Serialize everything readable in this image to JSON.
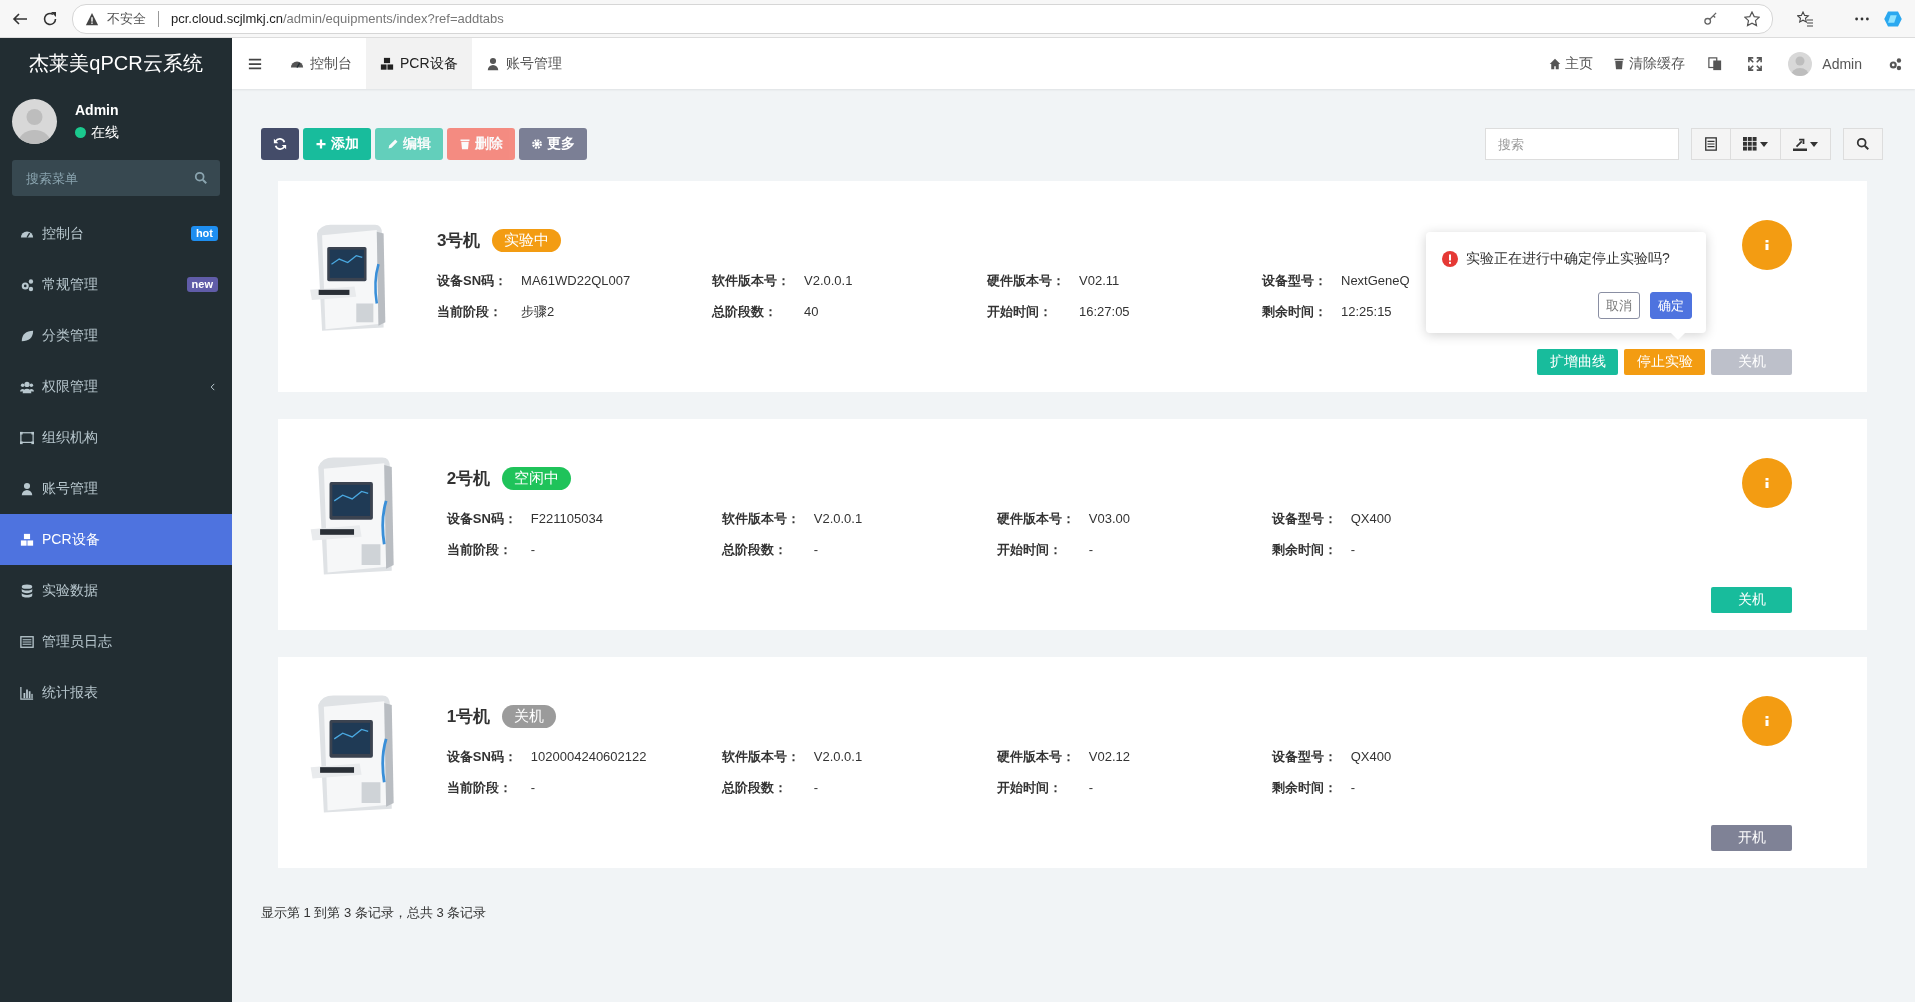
{
  "browser": {
    "security": "不安全",
    "url_host": "pcr.cloud.scjlmkj.cn",
    "url_path": "/admin/equipments/index?ref=addtabs"
  },
  "sidebar": {
    "logo": "杰莱美qPCR云系统",
    "user": {
      "name": "Admin",
      "status": "在线",
      "online": true
    },
    "search": {
      "placeholder": "搜索菜单"
    },
    "items": [
      {
        "label": "控制台",
        "selected": false,
        "badge": "hot",
        "color": "#1e8ef0",
        "expandable": false
      },
      {
        "label": "常规管理",
        "selected": false,
        "badge": "new",
        "color": "#605ca8",
        "expandable": false
      },
      {
        "label": "分类管理",
        "selected": false,
        "expandable": false
      },
      {
        "label": "权限管理",
        "selected": false,
        "expandable": true
      },
      {
        "label": "组织机构",
        "selected": false,
        "expandable": false
      },
      {
        "label": "账号管理",
        "selected": false,
        "expandable": false
      },
      {
        "label": "PCR设备",
        "selected": true,
        "expandable": false
      },
      {
        "label": "实验数据",
        "selected": false,
        "expandable": false
      },
      {
        "label": "管理员日志",
        "selected": false,
        "expandable": false
      },
      {
        "label": "统计报表",
        "selected": false,
        "expandable": false
      }
    ]
  },
  "header": {
    "tabs": [
      {
        "label": "控制台",
        "selected": false
      },
      {
        "label": "PCR设备",
        "selected": true
      },
      {
        "label": "账号管理",
        "selected": false
      }
    ],
    "links": [
      {
        "label": "主页"
      },
      {
        "label": "清除缓存"
      }
    ],
    "user": "Admin"
  },
  "toolbar": {
    "buttons": [
      {
        "kind": "refresh",
        "disabled": false
      },
      {
        "kind": "add",
        "label": "添加",
        "disabled": false
      },
      {
        "kind": "edit",
        "label": "编辑",
        "disabled": true
      },
      {
        "kind": "delete",
        "label": "删除",
        "disabled": true
      },
      {
        "kind": "more",
        "label": "更多",
        "disabled": false
      }
    ],
    "search": {
      "placeholder": "搜索"
    }
  },
  "devices": [
    {
      "name": "3号机",
      "status": {
        "label": "实验中",
        "kind": "running"
      },
      "fields": [
        {
          "label": "设备SN码：",
          "value": "MA61WD22QL007"
        },
        {
          "label": "软件版本号：",
          "value": "V2.0.0.1"
        },
        {
          "label": "硬件版本号：",
          "value": "V02.11"
        },
        {
          "label": "设备型号：",
          "value": "NextGeneQ"
        },
        {
          "label": "当前阶段：",
          "value": "步骤2"
        },
        {
          "label": "总阶段数：",
          "value": "40"
        },
        {
          "label": "开始时间：",
          "value": "16:27:05"
        },
        {
          "label": "剩余时间：",
          "value": "12:25:15"
        }
      ],
      "actions": [
        {
          "label": "扩增曲线",
          "kind": "success",
          "disabled": false
        },
        {
          "label": "停止实验",
          "kind": "warning",
          "disabled": false
        },
        {
          "label": "关机",
          "kind": "default",
          "disabled": true
        }
      ],
      "confirm_popup": {
        "message": "实验正在进行中确定停止实验吗?",
        "cancel": "取消",
        "confirm": "确定"
      }
    },
    {
      "name": "2号机",
      "status": {
        "label": "空闲中",
        "kind": "idle"
      },
      "fields": [
        {
          "label": "设备SN码：",
          "value": "F221105034"
        },
        {
          "label": "软件版本号：",
          "value": "V2.0.0.1"
        },
        {
          "label": "硬件版本号：",
          "value": "V03.00"
        },
        {
          "label": "设备型号：",
          "value": "QX400"
        },
        {
          "label": "当前阶段：",
          "value": "-"
        },
        {
          "label": "总阶段数：",
          "value": "-"
        },
        {
          "label": "开始时间：",
          "value": "-"
        },
        {
          "label": "剩余时间：",
          "value": "-"
        }
      ],
      "actions": [
        {
          "label": "关机",
          "kind": "success",
          "disabled": false
        }
      ]
    },
    {
      "name": "1号机",
      "status": {
        "label": "关机",
        "kind": "off"
      },
      "fields": [
        {
          "label": "设备SN码：",
          "value": "1020004240602122"
        },
        {
          "label": "软件版本号：",
          "value": "V2.0.0.1"
        },
        {
          "label": "硬件版本号：",
          "value": "V02.12"
        },
        {
          "label": "设备型号：",
          "value": "QX400"
        },
        {
          "label": "当前阶段：",
          "value": "-"
        },
        {
          "label": "总阶段数：",
          "value": "-"
        },
        {
          "label": "开始时间：",
          "value": "-"
        },
        {
          "label": "剩余时间：",
          "value": "-"
        }
      ],
      "actions": [
        {
          "label": "开机",
          "kind": "default",
          "disabled": false
        }
      ]
    }
  ],
  "footer": "显示第 1 到第 3 条记录，总共 3 条记录"
}
